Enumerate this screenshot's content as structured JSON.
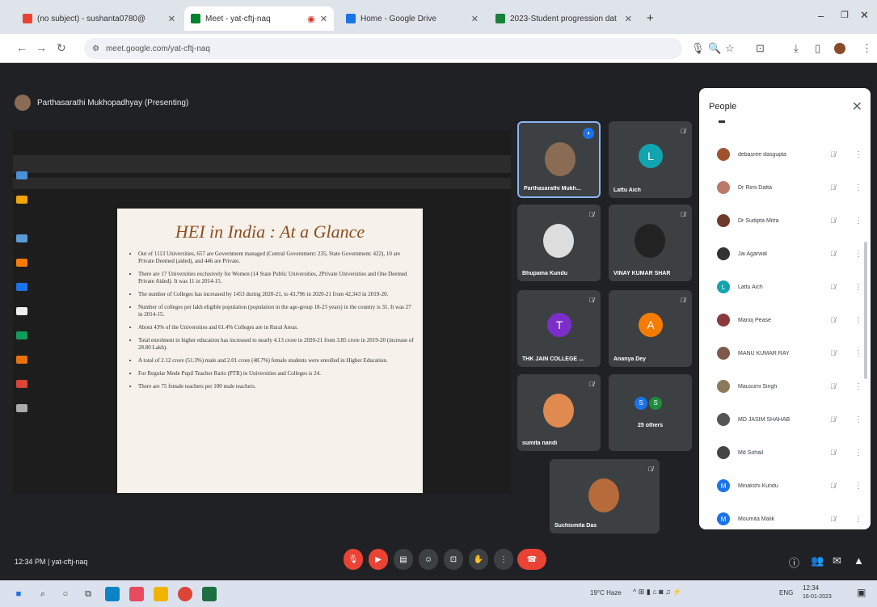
{
  "browser": {
    "tabs": [
      {
        "title": "(no subject) - sushanta0780@",
        "color": "#ea4335"
      },
      {
        "title": "Meet - yat-cftj-naq",
        "color": "#00832d"
      },
      {
        "title": "Home - Google Drive",
        "color": "#1a73e8"
      },
      {
        "title": "2023-Student progression dat",
        "color": "#188038"
      }
    ],
    "new_tab": "+",
    "url": "meet.google.com/yat-cftj-naq"
  },
  "meet": {
    "presenter": "Parthasarathi Mukhopadhyay (Presenting)",
    "slide": {
      "title": "HEI in India : At a Glance",
      "bullets": [
        "Out of 1113 Universities, 657 are Government managed (Central Government: 235, State Government: 422), 10 are Private Deemed (aided), and 446 are Private.",
        "There are 17 Universities exclusively for Women (14 State Public Universities, 2Private Universities and One Deemed Private Aided). It was 11 in 2014-15.",
        "The number of Colleges has increased by 1453 during 2020-21, to 43,796 in 2020-21 from 42,343 in 2019-20.",
        "Number of colleges per lakh eligible population (population in the age-group 18-23 years) in the country is 31. It was 27 in 2014-15.",
        "About 43% of the Universities and 61.4% Colleges are in Rural Areas.",
        "Total enrolment in higher education has increased to nearly 4.13 crore in 2020-21 from 3.85 crore in 2019-20 (increase of 28.80 Lakh).",
        "A total of 2.12 crore (51.3%) male and 2.01 crore (48.7%) female students were enrolled in Higher Education.",
        "For Regular Mode Pupil Teacher Ratio (PTR) in Universities and Colleges is 24.",
        "There are 75 female teachers per 100 male teachers."
      ]
    },
    "tiles": [
      {
        "name": "Parthasarathi Mukh...",
        "letter": "",
        "color": "#8a6b53"
      },
      {
        "name": "Lattu Aich",
        "letter": "L",
        "color": "#12a4af"
      },
      {
        "name": "Bhupama Kundu",
        "letter": "",
        "color": "#ddd"
      },
      {
        "name": "VINAY KUMAR SHAR",
        "letter": "",
        "color": "#222"
      },
      {
        "name": "THK JAIN COLLEGE ...",
        "letter": "T",
        "color": "#7c2ec8"
      },
      {
        "name": "Ananya Dey",
        "letter": "A",
        "color": "#f57c00"
      },
      {
        "name": "sumita nandi",
        "letter": "",
        "color": "#e08a4f"
      },
      {
        "name": "25 others",
        "letter": "",
        "color": "#1e8e3e"
      },
      {
        "name": "Suchismita Das",
        "letter": "",
        "color": "#b86b3a"
      }
    ],
    "people_panel": {
      "title": "People",
      "list": [
        {
          "name": "debasree dasgupta",
          "color": "#a0522d",
          "letter": ""
        },
        {
          "name": "Dr Rimi Datta",
          "color": "#b97a6a",
          "letter": ""
        },
        {
          "name": "Dr Sudipta Mitra",
          "color": "#6d3b2a",
          "letter": ""
        },
        {
          "name": "Jai Agarwal",
          "color": "#333",
          "letter": ""
        },
        {
          "name": "Lattu Aich",
          "color": "#12a4af",
          "letter": "L"
        },
        {
          "name": "Manoj Pease",
          "color": "#8b3a3a",
          "letter": ""
        },
        {
          "name": "MANU KUMAR RAY",
          "color": "#7d5a4a",
          "letter": ""
        },
        {
          "name": "Mausumi Singh",
          "color": "#8c7a5a",
          "letter": ""
        },
        {
          "name": "MD JASIM SHAHAB",
          "color": "#555",
          "letter": ""
        },
        {
          "name": "Md Sohail",
          "color": "#444",
          "letter": ""
        },
        {
          "name": "Minakshi Kundu",
          "color": "#1a73e8",
          "letter": "M"
        },
        {
          "name": "Moumita Malik",
          "color": "#1a73e8",
          "letter": "M"
        }
      ]
    },
    "bottom": {
      "time_code": "12:34 PM  |  yat-cftj-naq"
    }
  },
  "taskbar": {
    "weather": "19°C Haze",
    "lang": "ENG",
    "time": "12:34",
    "date": "16-01-2023"
  }
}
